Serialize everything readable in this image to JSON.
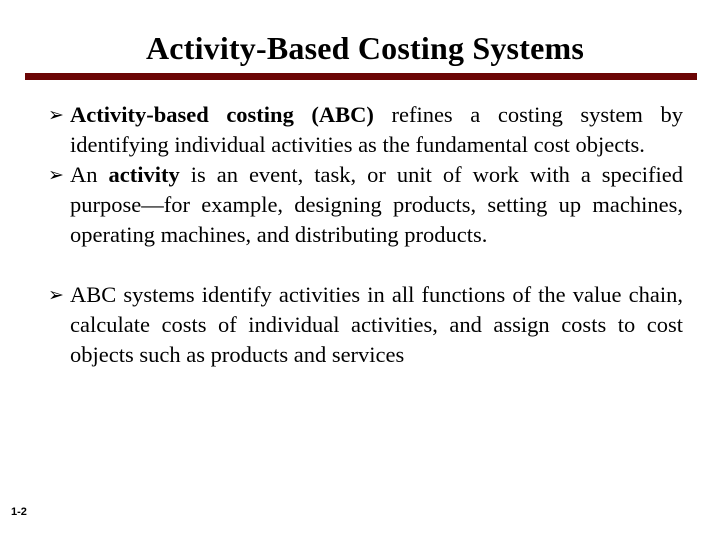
{
  "slide": {
    "title": "Activity-Based Costing Systems",
    "title_rule_color": "#6B0505",
    "background_color": "#FFFFFF",
    "text_color": "#000000",
    "footer_number": "1-2",
    "bullet_glyph": "➢",
    "bullets": [
      {
        "id": "bullet-abc-definition",
        "bold_lead": "Activity-based costing (ABC)",
        "rest": " refines a costing system by identifying individual activities as the fundamental cost objects."
      },
      {
        "id": "bullet-activity-definition",
        "lead": "An ",
        "bold_word": "activity",
        "rest": " is an event, task, or unit of work with a specified purpose—for example, designing products, setting up machines, operating machines, and distributing products."
      },
      {
        "id": "bullet-abc-systems",
        "text": "ABC systems identify activities in all functions of the value chain, calculate costs of individual activities, and assign costs to cost objects such as products and services"
      }
    ]
  }
}
